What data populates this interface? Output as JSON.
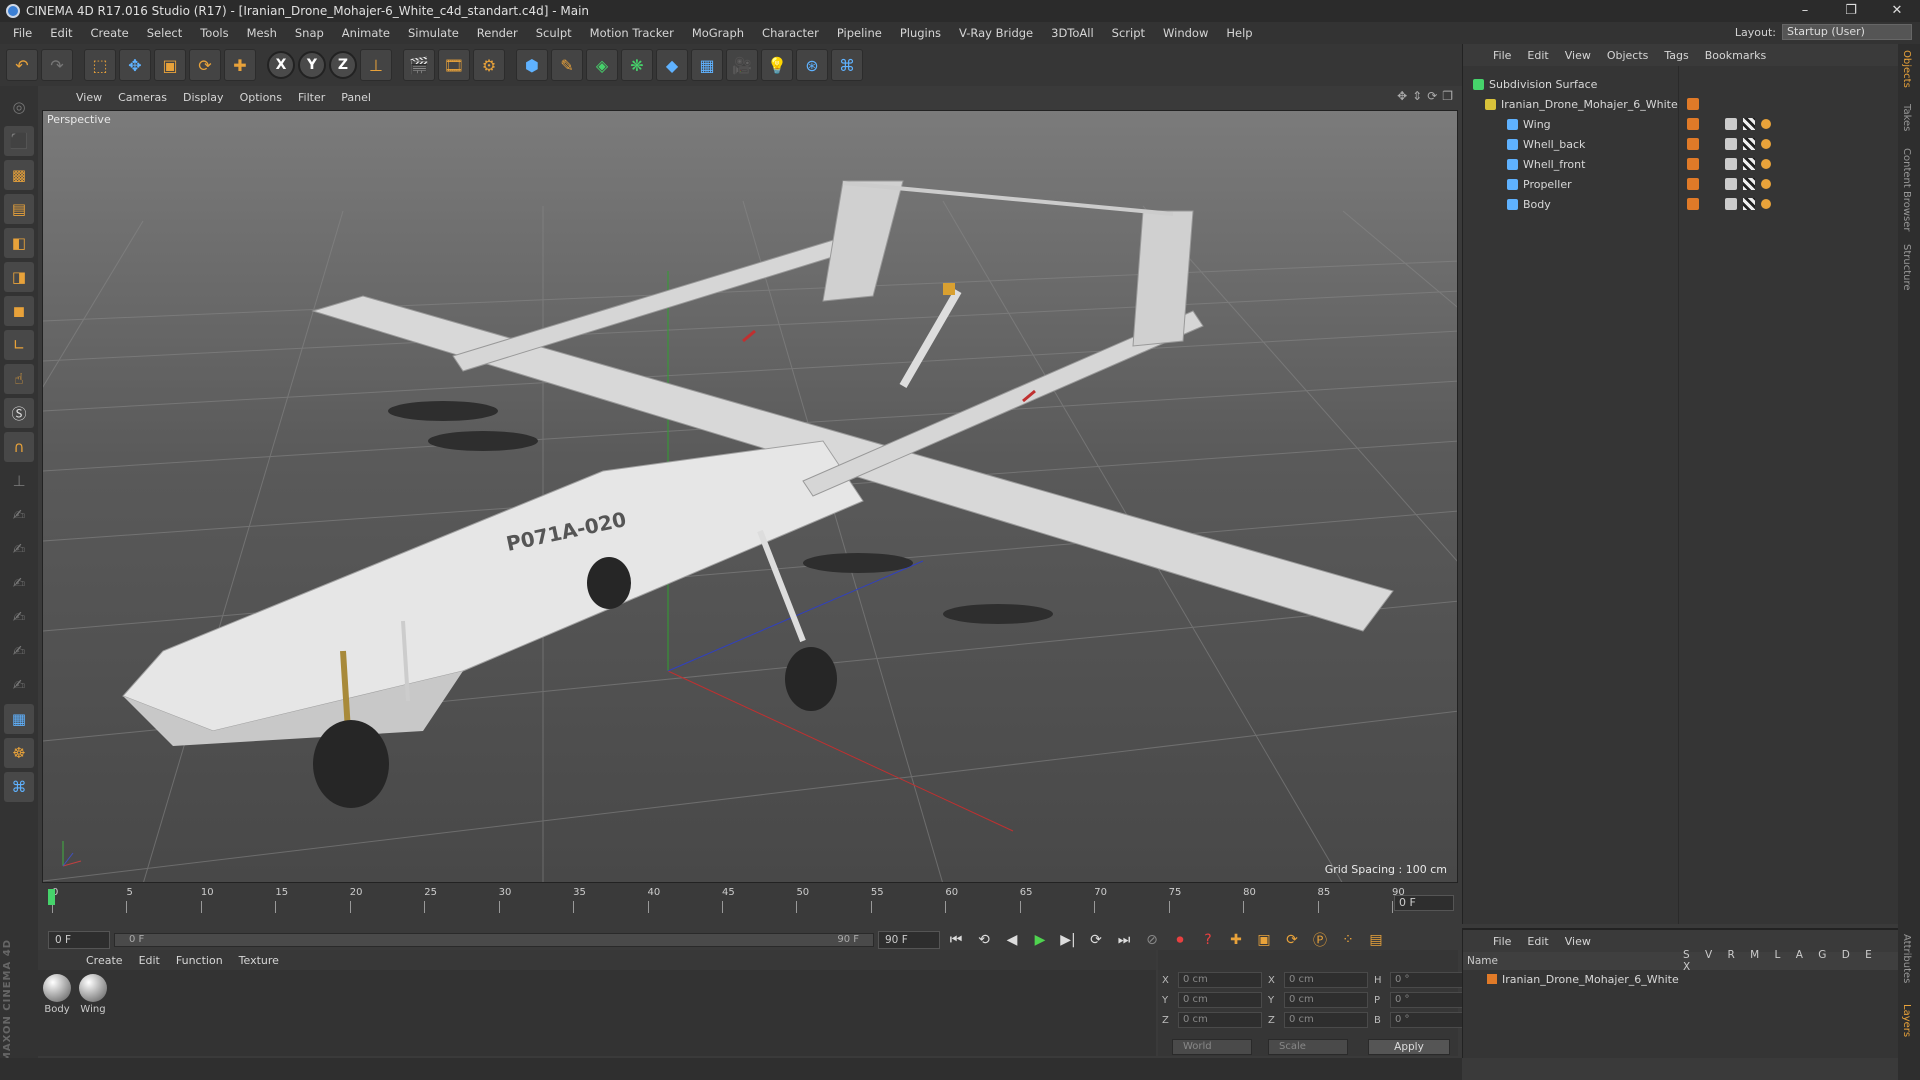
{
  "window": {
    "title": "CINEMA 4D R17.016 Studio (R17) - [Iranian_Drone_Mohajer-6_White_c4d_standart.c4d] - Main",
    "controls": [
      "–",
      "❐",
      "✕"
    ]
  },
  "menubar": {
    "items": [
      "File",
      "Edit",
      "Create",
      "Select",
      "Tools",
      "Mesh",
      "Snap",
      "Animate",
      "Simulate",
      "Render",
      "Sculpt",
      "Motion Tracker",
      "MoGraph",
      "Character",
      "Pipeline",
      "Plugins",
      "V-Ray Bridge",
      "3DToAll",
      "Script",
      "Window",
      "Help"
    ],
    "layout_label": "Layout:",
    "layout_value": "Startup (User)"
  },
  "toolbar": {
    "icons": [
      "undo-icon",
      "redo-icon",
      "live-selection-icon",
      "move-icon",
      "scale-icon",
      "rotate-icon",
      "move-tool-icon",
      "x-axis-icon",
      "y-axis-icon",
      "z-axis-icon",
      "coordinate-system-icon",
      "render-view-icon",
      "render-picture-viewer-icon",
      "edit-render-settings-icon",
      "cube-icon",
      "spline-pen-icon",
      "nurbs-icon",
      "array-icon",
      "deformer-icon",
      "floor-icon",
      "camera-icon",
      "light-icon",
      "vray-icon",
      "python-icon"
    ],
    "axis_labels": [
      "X",
      "Y",
      "Z"
    ]
  },
  "viewport": {
    "menu": [
      "View",
      "Cameras",
      "Display",
      "Options",
      "Filter",
      "Panel"
    ],
    "label": "Perspective",
    "grid_spacing": "Grid Spacing : 100 cm",
    "model_marking": "P071A-020"
  },
  "timeline": {
    "ticks": [
      "0",
      "5",
      "10",
      "15",
      "20",
      "25",
      "30",
      "35",
      "40",
      "45",
      "50",
      "55",
      "60",
      "65",
      "70",
      "75",
      "80",
      "85",
      "90"
    ],
    "current_frame": "0 F"
  },
  "playback": {
    "start_field": "0 F",
    "range_start": "0 F",
    "range_end": "90 F",
    "end_field": "90 F"
  },
  "material_manager": {
    "menu": [
      "Create",
      "Edit",
      "Function",
      "Texture"
    ],
    "materials": [
      {
        "name": "Body"
      },
      {
        "name": "Wing"
      }
    ]
  },
  "coordinates": {
    "rows": [
      {
        "a": "X",
        "av": "0 cm",
        "b": "X",
        "bv": "0 cm",
        "c": "H",
        "cv": "0 °"
      },
      {
        "a": "Y",
        "av": "0 cm",
        "b": "Y",
        "bv": "0 cm",
        "c": "P",
        "cv": "0 °"
      },
      {
        "a": "Z",
        "av": "0 cm",
        "b": "Z",
        "bv": "0 cm",
        "c": "B",
        "cv": "0 °"
      }
    ],
    "mode": "World",
    "transform": "Scale",
    "apply": "Apply"
  },
  "object_manager": {
    "menu": [
      "File",
      "Edit",
      "View",
      "Objects",
      "Tags",
      "Bookmarks"
    ],
    "objects": [
      {
        "name": "Subdivision Surface",
        "level": 0
      },
      {
        "name": "Iranian_Drone_Mohajer_6_White",
        "level": 1
      },
      {
        "name": "Wing",
        "level": 2
      },
      {
        "name": "Whell_back",
        "level": 2
      },
      {
        "name": "Whell_front",
        "level": 2
      },
      {
        "name": "Propeller",
        "level": 2
      },
      {
        "name": "Body",
        "level": 2
      }
    ]
  },
  "attribute_manager": {
    "menu": [
      "File",
      "Edit",
      "View"
    ],
    "name_header": "Name",
    "columns": "S V R M L A G D E X",
    "row_name": "Iranian_Drone_Mohajer_6_White"
  },
  "right_tabs": [
    "Objects",
    "Takes",
    "Content Browser",
    "Structure",
    "Attributes",
    "Layers"
  ],
  "brand": "MAXON CINEMA 4D",
  "colors": {
    "accent": "#e8a23a",
    "play": "#4fd34f",
    "record": "#e84040",
    "tag": "#e07a28"
  }
}
